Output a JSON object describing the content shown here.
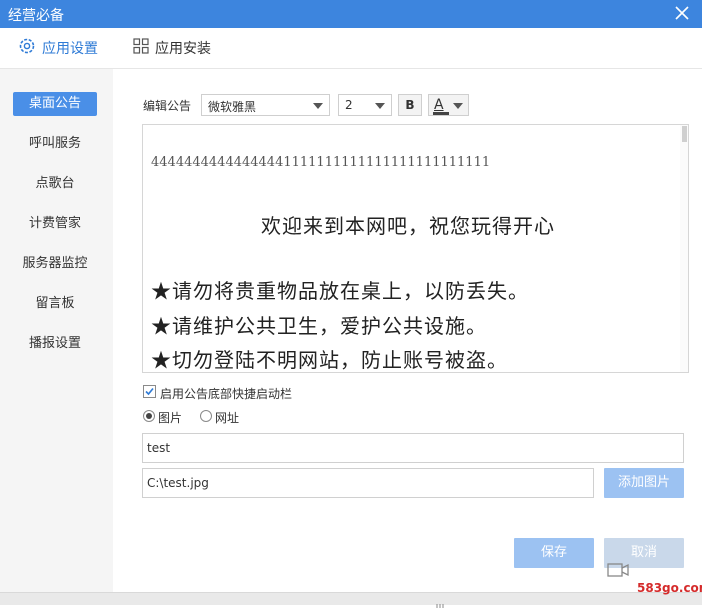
{
  "window": {
    "title": "经营必备"
  },
  "topnav": {
    "tabs": [
      {
        "label": "应用设置"
      },
      {
        "label": "应用安装"
      }
    ]
  },
  "sidebar": {
    "items": [
      {
        "label": "桌面公告"
      },
      {
        "label": "呼叫服务"
      },
      {
        "label": "点歌台"
      },
      {
        "label": "计费管家"
      },
      {
        "label": "服务器监控"
      },
      {
        "label": "留言板"
      },
      {
        "label": "播报设置"
      }
    ]
  },
  "editor_toolbar": {
    "label": "编辑公告",
    "font": "微软雅黑",
    "size": "2",
    "bold": "B",
    "color": "A"
  },
  "editor": {
    "line1": "44444444444444441111111111111111111111111",
    "welcome": "欢迎来到本网吧，祝您玩得开心",
    "rules": [
      "★请勿将贵重物品放在桌上，以防丢失。",
      "★请维护公共卫生，爱护公共设施。",
      "★切勿登陆不明网站，防止账号被盗。"
    ]
  },
  "options": {
    "enable_label": "启用公告底部快捷启动栏",
    "radio_image": "图片",
    "radio_url": "网址"
  },
  "fields": {
    "text_value": "test",
    "path_value": "C:\\test.jpg"
  },
  "buttons": {
    "add_image": "添加图片",
    "save": "保存",
    "cancel": "取消"
  },
  "watermark": {
    "text": "583go.com"
  },
  "colors": {
    "titlebar": "#3d85de",
    "accent": "#4a8fe7",
    "button": "#9cc2f2"
  }
}
